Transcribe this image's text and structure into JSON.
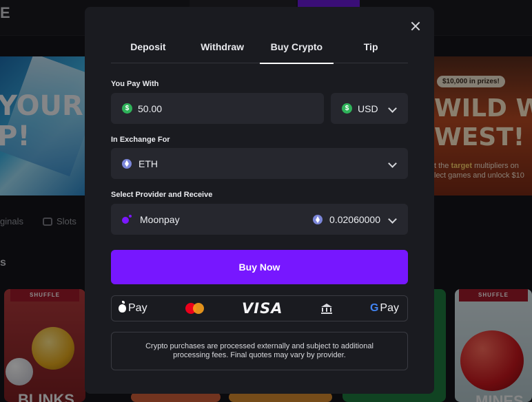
{
  "background": {
    "logo_text": "E",
    "banner_left_text": "YOUR\nP!",
    "banner_right": {
      "prize_badge": "$10,000 in prizes!",
      "title": "WILD WIL\nWEST!",
      "subtitle_prefix": "t the ",
      "subtitle_highlight": "target",
      "subtitle_rest": " multipliers on\nlect games and unlock $10"
    },
    "categories": [
      "ginals",
      "Slots"
    ],
    "section_heading": "s",
    "game_cards": [
      {
        "tag": "SHUFFLE",
        "title": "BLINKS"
      },
      {
        "tag": "SHUFFLE",
        "title": "MINES"
      }
    ]
  },
  "modal": {
    "tabs": [
      {
        "label": "Deposit",
        "active": false
      },
      {
        "label": "Withdraw",
        "active": false
      },
      {
        "label": "Buy Crypto",
        "active": true
      },
      {
        "label": "Tip",
        "active": false
      }
    ],
    "pay_with": {
      "label": "You Pay With",
      "amount": "50.00",
      "currency": "USD",
      "currency_symbol": "$"
    },
    "exchange_for": {
      "label": "In Exchange For",
      "coin": "ETH"
    },
    "provider": {
      "label": "Select Provider and Receive",
      "name": "Moonpay",
      "receive_amount": "0.02060000"
    },
    "buy_button": "Buy Now",
    "payment_methods": {
      "apple_pay": "Pay",
      "visa": "VISA",
      "google_g": "G",
      "google_pay": "Pay"
    },
    "note": "Crypto purchases are processed externally and subject to additional processing fees. Final quotes may vary by provider."
  },
  "colors": {
    "accent": "#7717ff",
    "modal_bg": "#1a1b20",
    "field_bg": "#26272e",
    "dollar_green": "#2fb35a",
    "eth_blue": "#7b86d9"
  }
}
